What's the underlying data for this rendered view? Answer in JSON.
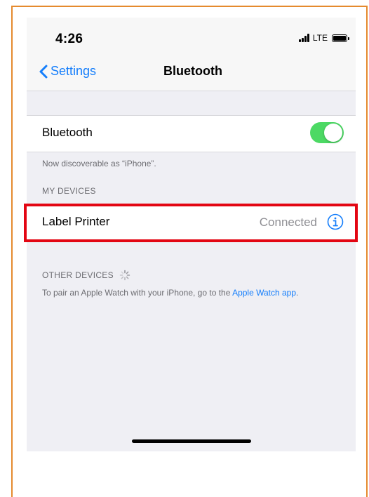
{
  "status_bar": {
    "time": "4:26",
    "network": "LTE"
  },
  "nav": {
    "back_label": "Settings",
    "title": "Bluetooth"
  },
  "bluetooth": {
    "label": "Bluetooth",
    "enabled": true,
    "toggle_color": "#4cd964",
    "discoverable_text": "Now discoverable as “iPhone”."
  },
  "my_devices": {
    "header": "MY DEVICES",
    "items": [
      {
        "name": "Label Printer",
        "status": "Connected"
      }
    ]
  },
  "other_devices": {
    "header": "OTHER DEVICES",
    "pair_text": "To pair an Apple Watch with your iPhone, go to the ",
    "pair_link": "Apple Watch app",
    "pair_suffix": "."
  },
  "colors": {
    "accent": "#157efb",
    "highlight_box": "#e30613",
    "frame": "#e58a2e"
  }
}
